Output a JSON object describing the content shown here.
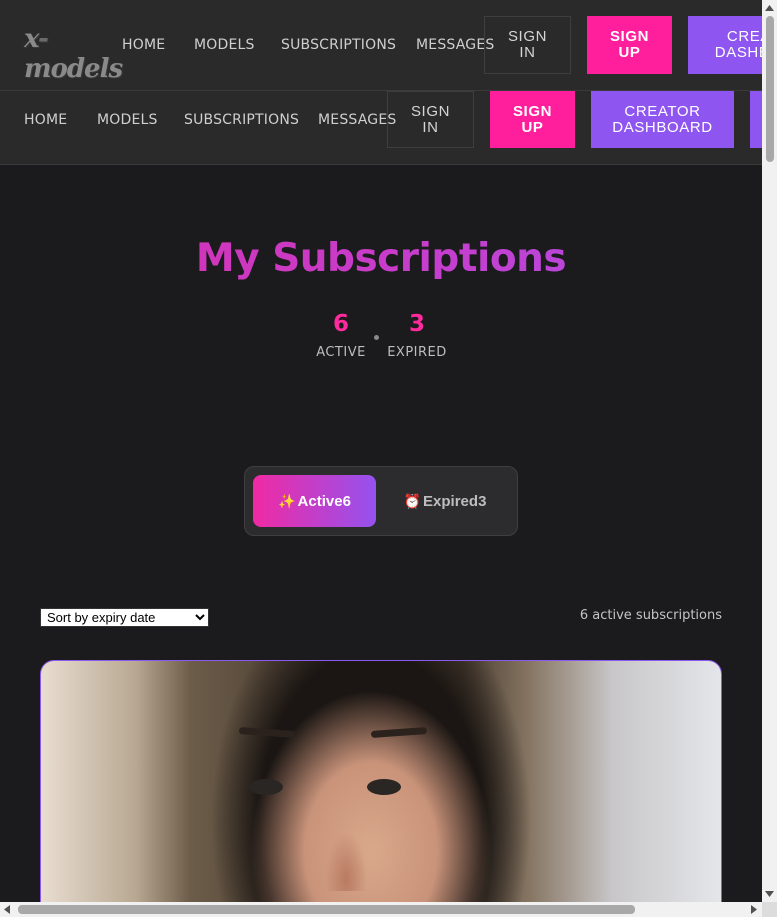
{
  "app": {
    "logo_text": "x-models"
  },
  "nav_primary": {
    "links": [
      "HOME",
      "MODELS",
      "SUBSCRIPTIONS",
      "MESSAGES"
    ],
    "sign_in": "SIGN IN",
    "sign_up": "SIGN UP",
    "creator_dashboard": "CREATOR DASHBOARD"
  },
  "nav_secondary": {
    "links": [
      "HOME",
      "MODELS",
      "SUBSCRIPTIONS",
      "MESSAGES"
    ],
    "sign_in": "SIGN IN",
    "sign_up": "SIGN UP",
    "creator_dashboard": "CREATOR DASHBOARD"
  },
  "page": {
    "title": "My Subscriptions",
    "stats": [
      {
        "value": "6",
        "label": "ACTIVE"
      },
      {
        "value": "3",
        "label": "EXPIRED"
      }
    ]
  },
  "tabs": [
    {
      "icon": "sparkles-icon",
      "glyph": "✨",
      "label": "Active",
      "count": "6"
    },
    {
      "icon": "alarm-clock-icon",
      "glyph": "⏰",
      "label": "Expired",
      "count": "3"
    }
  ],
  "list": {
    "sort_selected": "Sort by expiry date",
    "result_count": "6 active subscriptions"
  },
  "colors": {
    "accent_pink": "#ff1f9c",
    "accent_purple": "#8f55f1",
    "background": "#1b1a1c",
    "header": "#2a2a2b"
  }
}
